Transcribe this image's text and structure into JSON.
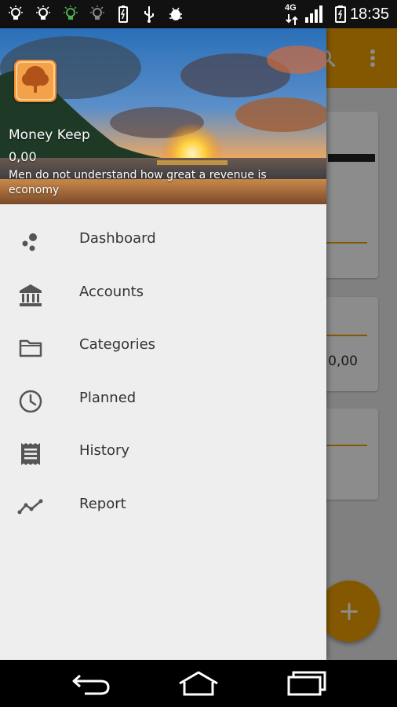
{
  "status_bar": {
    "network": "4G",
    "time": "18:35",
    "icons": [
      "bulb-icon",
      "bulb-icon",
      "bulb-green-icon",
      "bulb-icon",
      "battery-charging-icon",
      "usb-icon",
      "android-debug-icon",
      "signal-icon",
      "battery-icon"
    ]
  },
  "app_background": {
    "toolbar_actions": [
      "search-icon",
      "overflow-menu-icon"
    ],
    "card_value": "0,00",
    "fab_label": "+"
  },
  "drawer": {
    "header": {
      "title": "Money Keep",
      "amount": "0,00",
      "quote": "Men do not understand how great a revenue is economy"
    },
    "menu": [
      {
        "label": "Dashboard",
        "icon": "dashboard-icon"
      },
      {
        "label": "Accounts",
        "icon": "bank-icon"
      },
      {
        "label": "Categories",
        "icon": "folder-icon"
      },
      {
        "label": "Planned",
        "icon": "clock-icon"
      },
      {
        "label": "History",
        "icon": "receipt-icon"
      },
      {
        "label": "Report",
        "icon": "trend-line-icon"
      }
    ]
  },
  "nav_bar": {
    "buttons": [
      "back-icon",
      "home-icon",
      "recents-icon"
    ]
  },
  "colors": {
    "accent": "#f0a000",
    "drawer_bg": "#eeeeee",
    "icon_gray": "#555555",
    "status_bar": "#111111"
  }
}
